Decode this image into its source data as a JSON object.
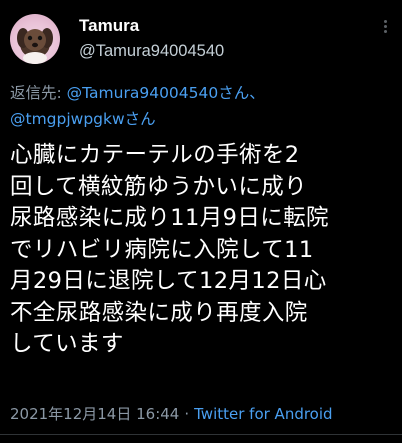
{
  "author": {
    "display_name": "Tamura",
    "handle": "@Tamura94004540",
    "avatar_icon": "dog-icon"
  },
  "reply": {
    "prefix": "返信先: ",
    "user1": "@Tamura94004540さん、",
    "user2": "@tmgpjwpgkwさん"
  },
  "tweet_lines": [
    "心臓にカテーテルの手術を2",
    "回して横紋筋ゆうかいに成り",
    "尿路感染に成り11月9日に転院",
    "でリハビリ病院に入院して11",
    "月29日に退院して12月12日心",
    "不全尿路感染に成り再度入院",
    "しています"
  ],
  "meta": {
    "timestamp": "2021年12月14日 16:44",
    "separator": "·",
    "source": "Twitter for Android"
  },
  "colors": {
    "background": "#000000",
    "text": "#ffffff",
    "secondary": "#8b98a5",
    "link": "#4a9ff0"
  }
}
